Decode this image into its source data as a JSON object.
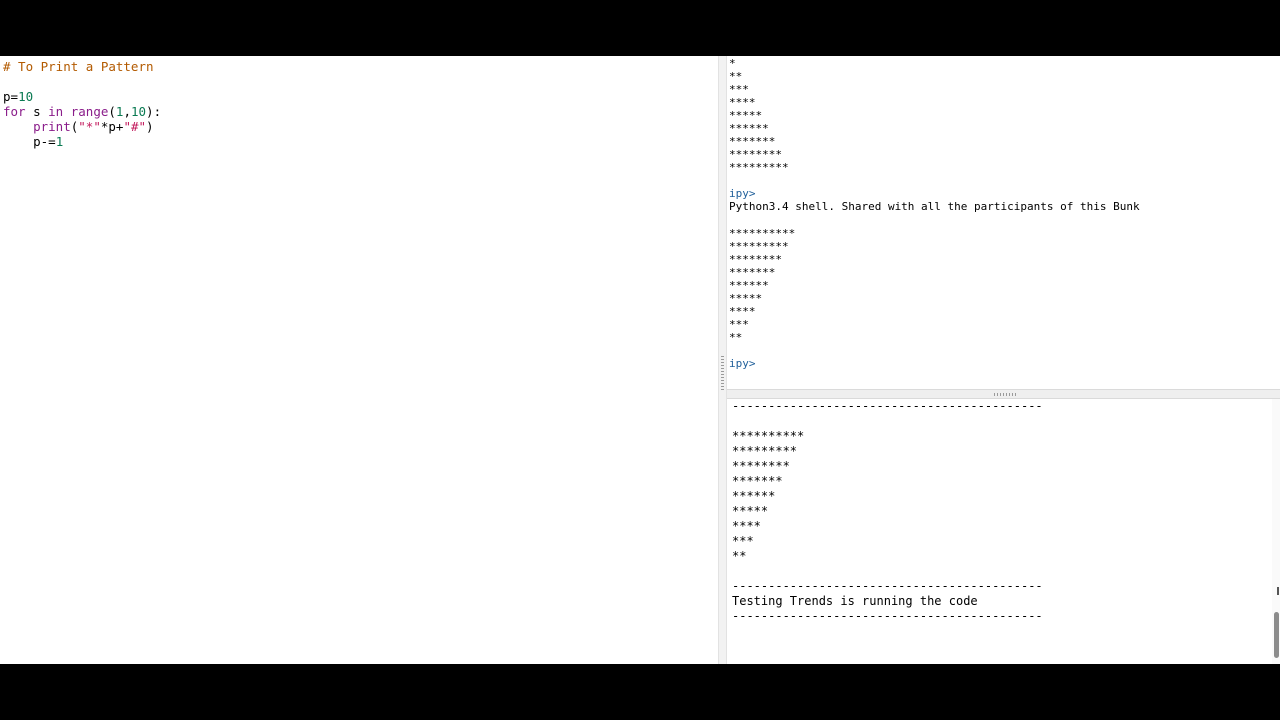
{
  "editor": {
    "comment": "# To Print a Pattern",
    "line_p_name": "p=",
    "line_p_value": "10",
    "loop_for": "for",
    "loop_mid": " s ",
    "loop_in": "in",
    "loop_range": "range",
    "loop_args_open": "(",
    "loop_arg1": "1",
    "loop_comma": ",",
    "loop_arg2": "10",
    "loop_close": "):",
    "print_fn": "print",
    "print_open": "(",
    "print_str1": "\"*\"",
    "print_mid": "*p+",
    "print_str2": "\"#\"",
    "print_close": ")",
    "decrement_name": "p-=",
    "decrement_value": "1"
  },
  "shell": {
    "lines_top": [
      "*",
      "**",
      "***",
      "****",
      "*****",
      "******",
      "*******",
      "********",
      "*********"
    ],
    "prompt1": "ipy>",
    "info": "Python3.4 shell. Shared with all the participants of this Bunk",
    "lines_bottom": [
      "**********",
      "*********",
      "********",
      "*******",
      "******",
      "*****",
      "****",
      "***",
      "**"
    ],
    "prompt2": "ipy>"
  },
  "output": {
    "separator": "-------------------------------------------",
    "lines": [
      "**********",
      "*********",
      "********",
      "*******",
      "******",
      "*****",
      "****",
      "***",
      "**"
    ],
    "status": "Testing Trends is running the code"
  }
}
